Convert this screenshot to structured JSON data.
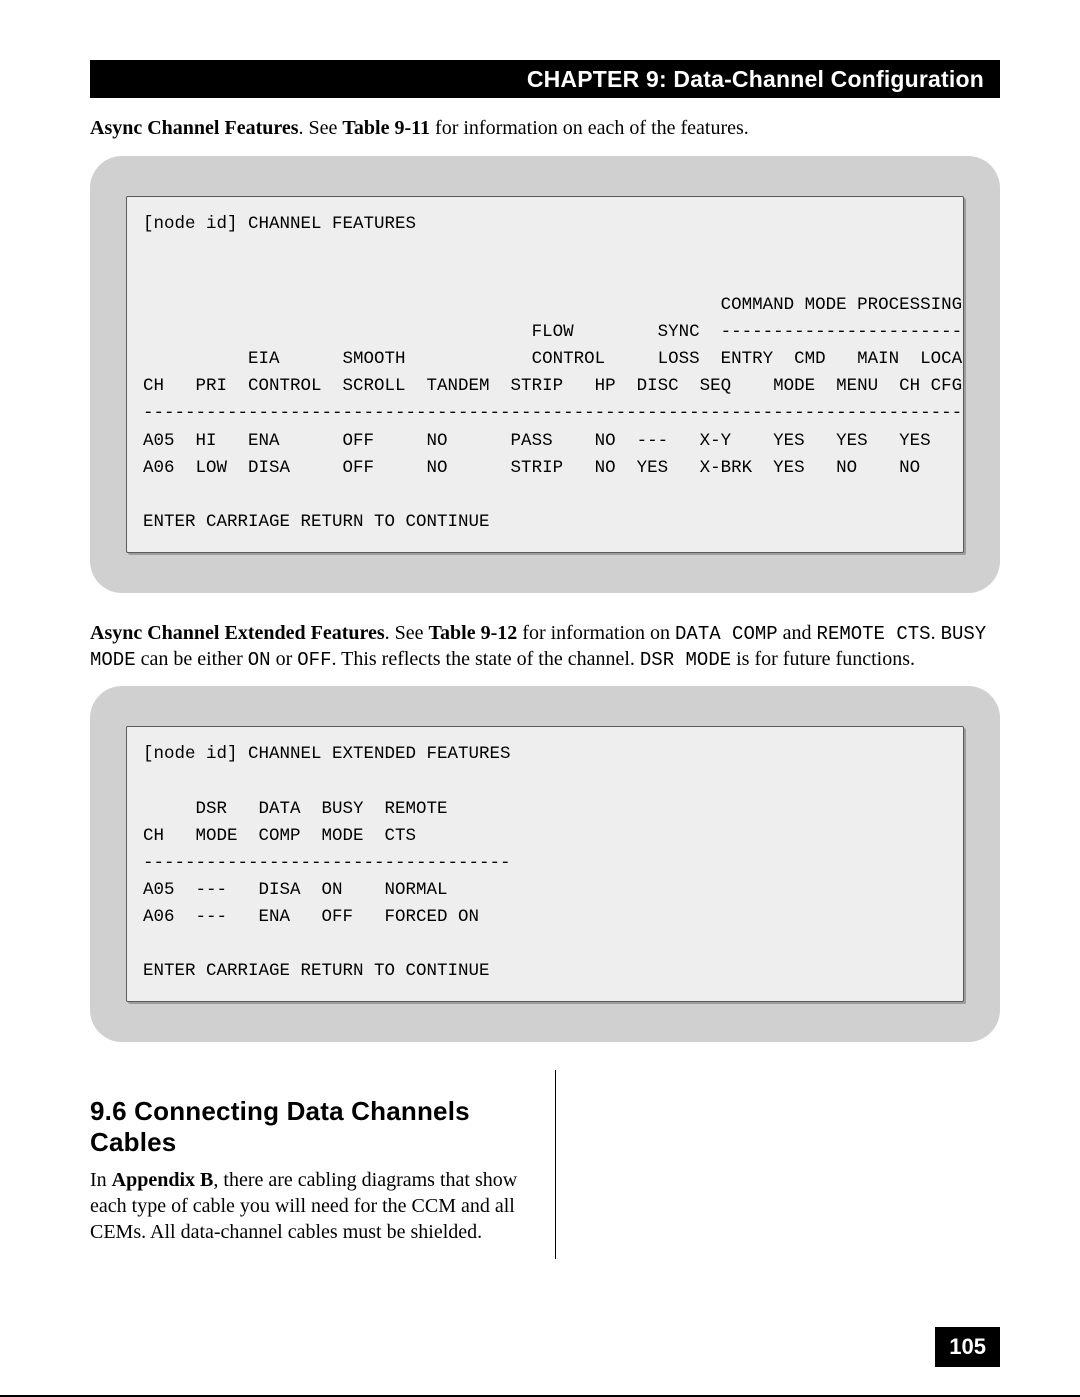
{
  "chapter_bar": "CHAPTER 9: Data-Channel Configuration",
  "para1": {
    "bold": "Async Channel Features",
    "a": ". See ",
    "bold2": "Table 9-11",
    "b": " for information on each of the features."
  },
  "terminal1": {
    "line1": "[node id] CHANNEL FEATURES",
    "line2": "                                                       COMMAND MODE PROCESSING",
    "line3": "                                     FLOW        SYNC  ------------------------",
    "line4": "          EIA      SMOOTH            CONTROL     LOSS  ENTRY  CMD   MAIN  LOCAL",
    "line5": "CH   PRI  CONTROL  SCROLL  TANDEM  STRIP   HP  DISC  SEQ    MODE  MENU  CH CFG",
    "line6": "------------------------------------------------------------------------------",
    "line7": "A05  HI   ENA      OFF     NO      PASS    NO  ---   X-Y    YES   YES   YES",
    "line8": "A06  LOW  DISA     OFF     NO      STRIP   NO  YES   X-BRK  YES   NO    NO",
    "line9": "ENTER CARRIAGE RETURN TO CONTINUE"
  },
  "para2": {
    "bold": "Async Channel Extended Features",
    "a": ". See ",
    "bold2": "Table 9-12",
    "b": " for information on ",
    "code1": "DATA COMP",
    "c": " and ",
    "code2": "REMOTE CTS",
    "d": ". ",
    "code3": "BUSY MODE",
    "e": " can be either ",
    "code4": "ON",
    "f": " or ",
    "code5": "OFF",
    "g": ". This reflects the state of the channel. ",
    "code6": "DSR MODE",
    "h": " is for future functions."
  },
  "terminal2": {
    "line1": "[node id] CHANNEL EXTENDED FEATURES",
    "line2": "     DSR   DATA  BUSY  REMOTE",
    "line3": "CH   MODE  COMP  MODE  CTS",
    "line4": "-----------------------------------",
    "line5": "A05  ---   DISA  ON    NORMAL",
    "line6": "A06  ---   ENA   OFF   FORCED ON",
    "line7": "ENTER CARRIAGE RETURN TO CONTINUE"
  },
  "section96": {
    "heading": "9.6  Connecting Data Channels Cables",
    "a": "In ",
    "bold": "Appendix B",
    "b": ", there are cabling diagrams that show each type of cable you will need for the CCM and all CEMs. All data-channel cables must be shielded."
  },
  "page_number": "105",
  "chart_data": [
    {
      "type": "table",
      "title": "CHANNEL FEATURES",
      "columns": [
        "CH",
        "PRI",
        "EIA CONTROL",
        "SMOOTH SCROLL",
        "TANDEM",
        "FLOW CONTROL STRIP",
        "HP",
        "SYNC LOSS DISC",
        "ENTRY SEQ",
        "CMD MODE",
        "MAIN MENU",
        "LOCAL CH CFG"
      ],
      "rows": [
        [
          "A05",
          "HI",
          "ENA",
          "OFF",
          "NO",
          "PASS",
          "NO",
          "---",
          "X-Y",
          "YES",
          "YES",
          "YES"
        ],
        [
          "A06",
          "LOW",
          "DISA",
          "OFF",
          "NO",
          "STRIP",
          "NO",
          "YES",
          "X-BRK",
          "YES",
          "NO",
          "NO"
        ]
      ]
    },
    {
      "type": "table",
      "title": "CHANNEL EXTENDED FEATURES",
      "columns": [
        "CH",
        "DSR MODE",
        "DATA COMP",
        "BUSY MODE",
        "REMOTE CTS"
      ],
      "rows": [
        [
          "A05",
          "---",
          "DISA",
          "ON",
          "NORMAL"
        ],
        [
          "A06",
          "---",
          "ENA",
          "OFF",
          "FORCED ON"
        ]
      ]
    }
  ]
}
